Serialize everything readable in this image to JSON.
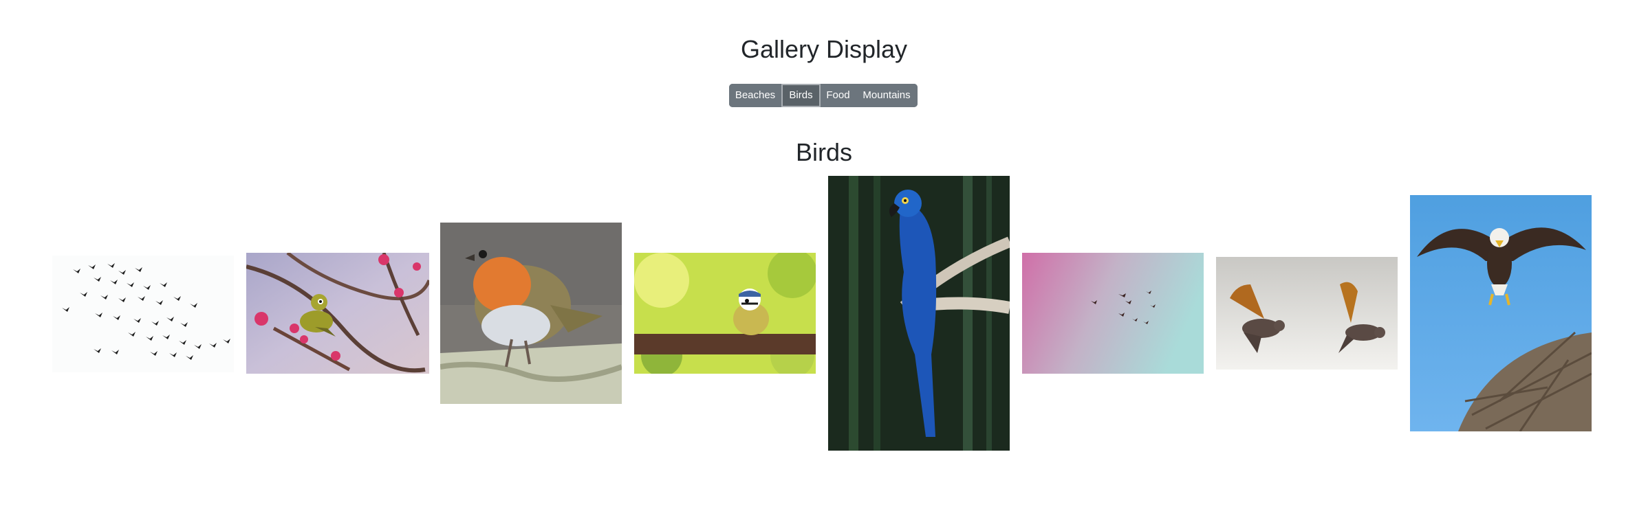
{
  "header": {
    "title": "Gallery Display"
  },
  "categories": {
    "beaches": "Beaches",
    "birds": "Birds",
    "food": "Food",
    "mountains": "Mountains",
    "selected": "Birds"
  },
  "section": {
    "title": "Birds"
  },
  "gallery": {
    "images": [
      "flock-of-birds-image",
      "white-eye-bird-on-blossom-image",
      "robin-on-branch-image",
      "blue-tit-on-branch-image",
      "blue-macaw-image",
      "birds-in-pink-sky-image",
      "two-doves-flying-image",
      "eagle-over-nest-image"
    ]
  },
  "colors": {
    "button_bg": "#6c757d",
    "button_active_bg": "#5a6268",
    "text": "#212529"
  }
}
